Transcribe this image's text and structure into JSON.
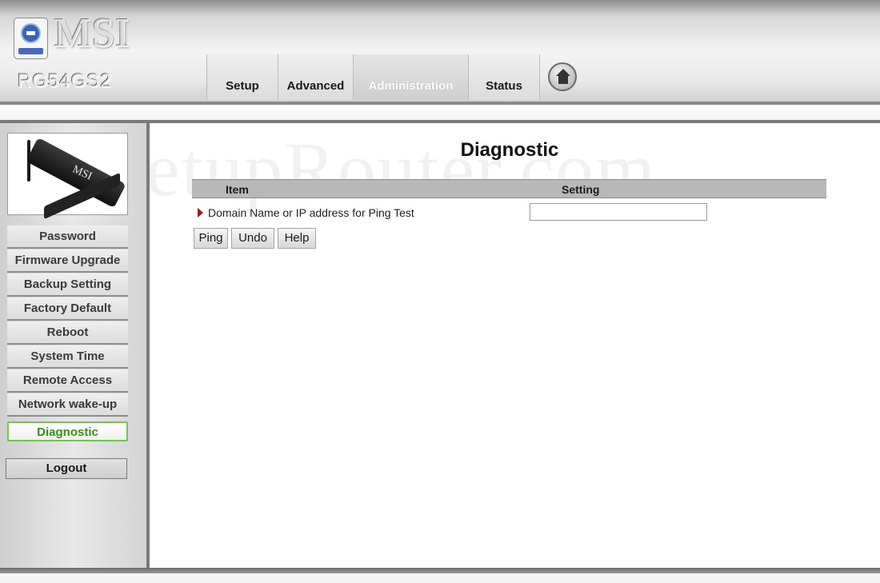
{
  "header": {
    "brand": "MSI",
    "model": "RG54GS2",
    "tabs": [
      {
        "label": "Setup",
        "active": false
      },
      {
        "label": "Advanced",
        "active": false
      },
      {
        "label": "Administration",
        "active": true
      },
      {
        "label": "Status",
        "active": false
      }
    ],
    "home_icon": "home-icon"
  },
  "sidebar": {
    "items": [
      {
        "label": "Password"
      },
      {
        "label": "Firmware Upgrade"
      },
      {
        "label": "Backup Setting"
      },
      {
        "label": "Factory Default"
      },
      {
        "label": "Reboot"
      },
      {
        "label": "System Time"
      },
      {
        "label": "Remote Access"
      },
      {
        "label": "Network wake-up"
      },
      {
        "label": "Diagnostic",
        "active": true
      }
    ],
    "logout_label": "Logout"
  },
  "main": {
    "watermark": "SetupRouter.com",
    "title": "Diagnostic",
    "columns": {
      "item": "Item",
      "setting": "Setting"
    },
    "row": {
      "label": "Domain Name or IP address for Ping Test",
      "value": "",
      "placeholder": ""
    },
    "buttons": {
      "ping": "Ping",
      "undo": "Undo",
      "help": "Help"
    }
  },
  "colors": {
    "active_nav_text": "#3a8d1c",
    "active_nav_border": "#7bbf5b",
    "row_marker": "#9b1d1d",
    "table_header_bg": "#b8b8b8"
  }
}
